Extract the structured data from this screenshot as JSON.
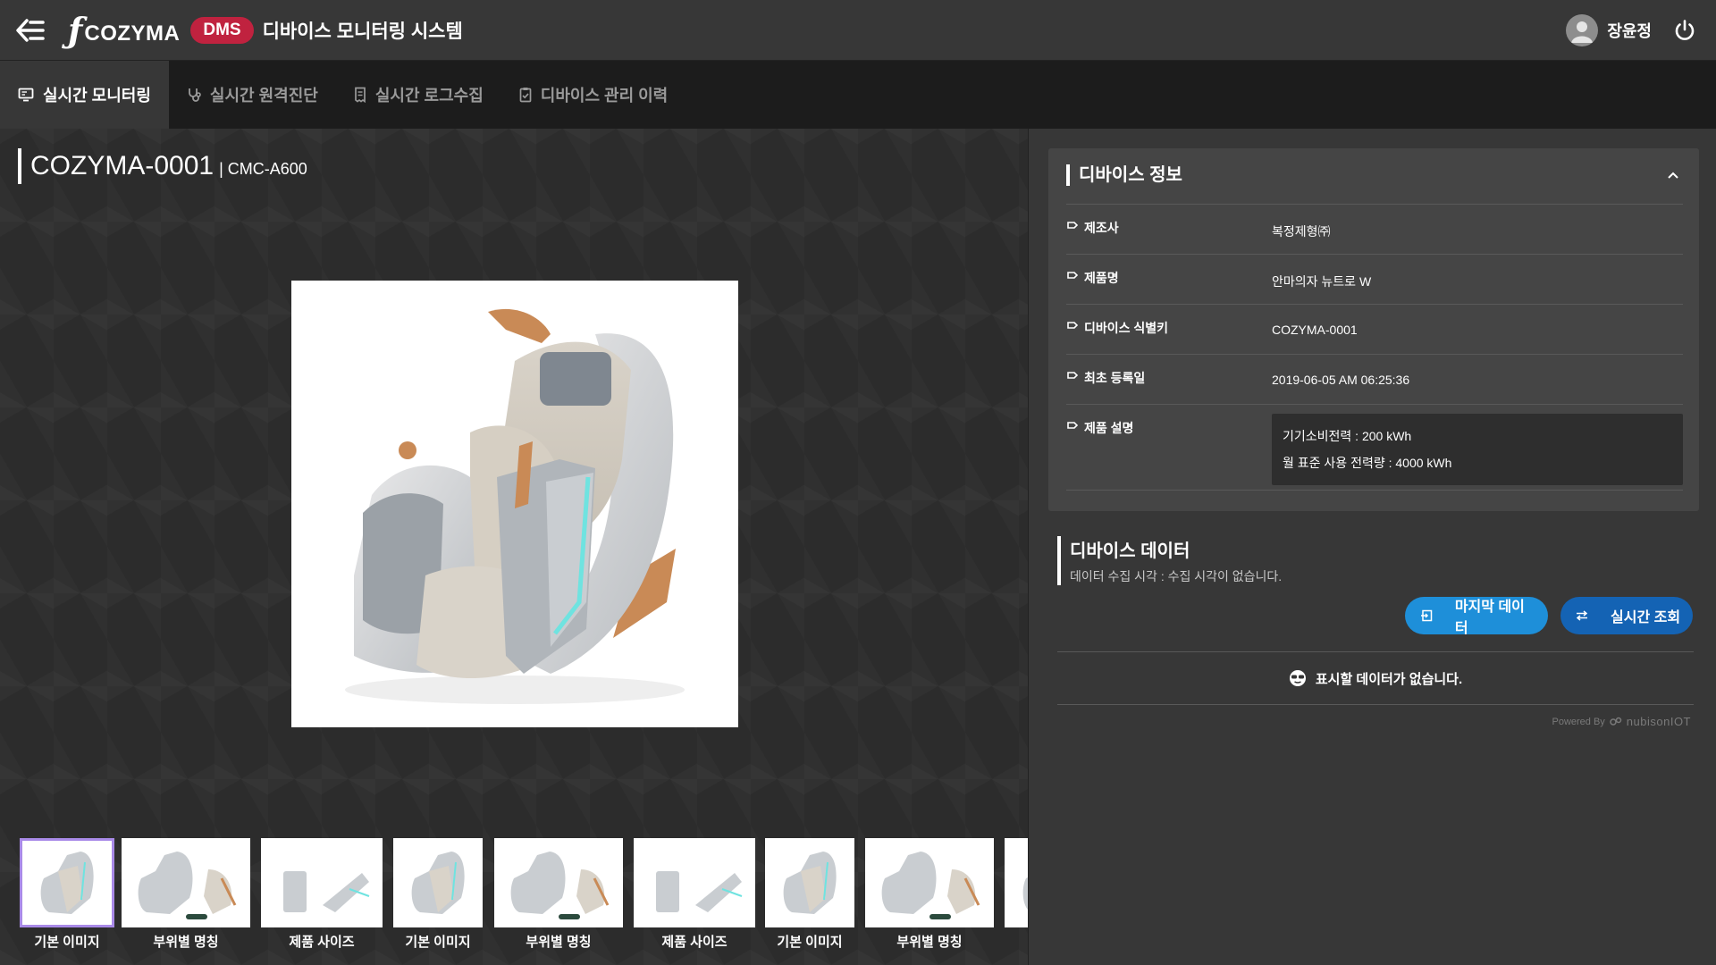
{
  "header": {
    "logo_text": "COZYMA",
    "badge": "DMS",
    "title": "디바이스 모니터링 시스템",
    "user_name": "장윤정"
  },
  "tabs": [
    {
      "label": "실시간 모니터링",
      "icon": "monitor-icon",
      "active": true
    },
    {
      "label": "실시간 원격진단",
      "icon": "stethoscope-icon",
      "active": false
    },
    {
      "label": "실시간 로그수집",
      "icon": "receipt-icon",
      "active": false
    },
    {
      "label": "디바이스 관리 이력",
      "icon": "clipboard-check-icon",
      "active": false
    }
  ],
  "device": {
    "id": "COZYMA-0001",
    "model": "| CMC-A600"
  },
  "thumbnails": [
    {
      "label": "기본 이미지",
      "selected": true
    },
    {
      "label": "부위별 명칭",
      "selected": false
    },
    {
      "label": "제품 사이즈",
      "selected": false
    },
    {
      "label": "기본 이미지",
      "selected": false
    },
    {
      "label": "부위별 명칭",
      "selected": false
    },
    {
      "label": "제품 사이즈",
      "selected": false
    },
    {
      "label": "기본 이미지",
      "selected": false
    },
    {
      "label": "부위별 명칭",
      "selected": false
    }
  ],
  "device_info": {
    "title": "디바이스 정보",
    "rows": [
      {
        "key": "제조사",
        "value": "복정제형㈜"
      },
      {
        "key": "제품명",
        "value": "안마의자 뉴트로 W"
      },
      {
        "key": "디바이스 식별키",
        "value": "COZYMA-0001"
      },
      {
        "key": "최초 등록일",
        "value": "2019-06-05 AM 06:25:36"
      }
    ],
    "desc_key": "제품 설명",
    "desc_lines": [
      "기기소비전력 : 200 kWh",
      "월 표준 사용 전력량 : 4000 kWh"
    ]
  },
  "device_data": {
    "title": "디바이스 데이터",
    "subtitle": "데이터 수집 시각 : 수집 시각이 없습니다.",
    "btn_last": "마지막 데이터",
    "btn_live": "실시간 조회",
    "no_data": "표시할 데이터가 없습니다.",
    "powered_by": "Powered By",
    "powered_brand": "nubisonIOT"
  },
  "colors": {
    "badge": "#c0223f",
    "btn_last": "#1e8fd9",
    "btn_live": "#1463b4",
    "thumb_selected": "#a98ae8"
  }
}
